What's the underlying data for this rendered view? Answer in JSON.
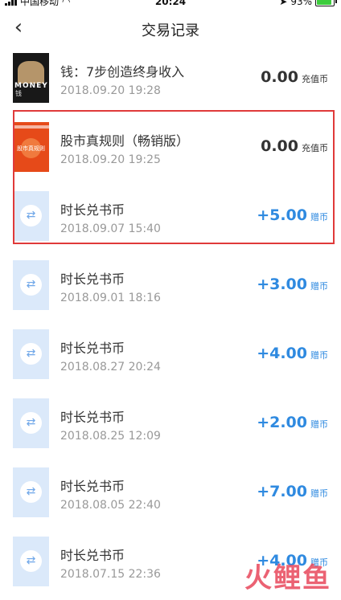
{
  "status_bar": {
    "carrier": "中国移动",
    "time": "20:24",
    "battery": "93%"
  },
  "header": {
    "title": "交易记录",
    "back_icon": "chevron-left-icon"
  },
  "transactions": [
    {
      "name": "钱：7步创造终身收入",
      "date": "2018.09.20 19:28",
      "amount": "0.00",
      "unit": "充值币",
      "thumb": "book",
      "cover_word": "MONEY",
      "cover_sub": "钱"
    },
    {
      "name": "股市真规则（畅销版）",
      "date": "2018.09.20 19:25",
      "amount": "0.00",
      "unit": "充值币",
      "thumb": "book",
      "cover_word": "股市真规则"
    },
    {
      "name": "时长兑书币",
      "date": "2018.09.07 15:40",
      "amount": "+5.00",
      "unit": "赠币",
      "thumb": "exchange"
    },
    {
      "name": "时长兑书币",
      "date": "2018.09.01 18:16",
      "amount": "+3.00",
      "unit": "赠币",
      "thumb": "exchange"
    },
    {
      "name": "时长兑书币",
      "date": "2018.08.27 20:24",
      "amount": "+4.00",
      "unit": "赠币",
      "thumb": "exchange"
    },
    {
      "name": "时长兑书币",
      "date": "2018.08.25 12:09",
      "amount": "+2.00",
      "unit": "赠币",
      "thumb": "exchange"
    },
    {
      "name": "时长兑书币",
      "date": "2018.08.05 22:40",
      "amount": "+7.00",
      "unit": "赠币",
      "thumb": "exchange"
    },
    {
      "name": "时长兑书币",
      "date": "2018.07.15 22:36",
      "amount": "+4.00",
      "unit": "赠币",
      "thumb": "exchange"
    }
  ],
  "colors": {
    "accent_blue": "#2f8ae0",
    "highlight_red": "#e03a3a",
    "exchange_bg": "#dbe9fa"
  },
  "watermark": "火鲤鱼"
}
